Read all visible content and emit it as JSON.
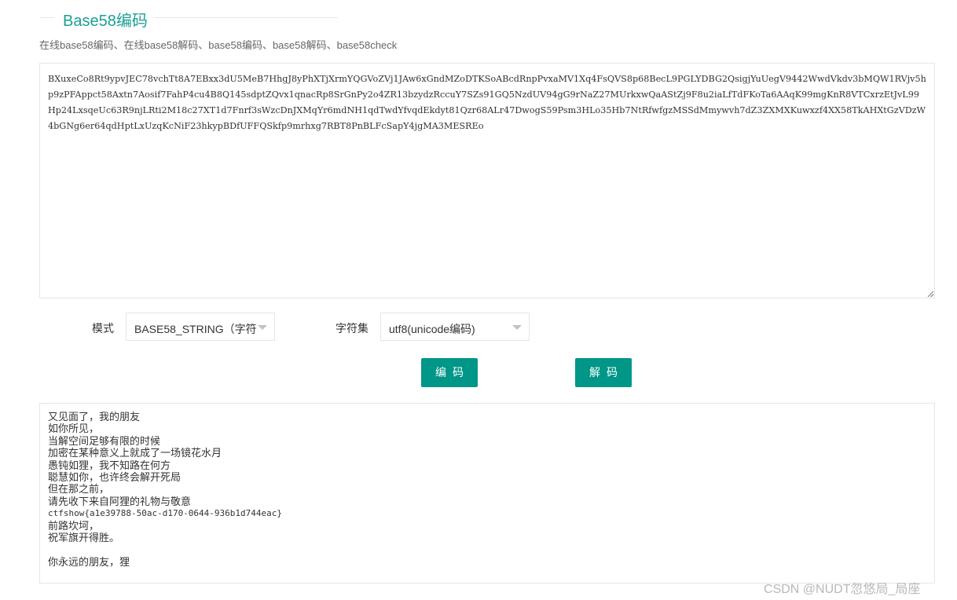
{
  "header": {
    "title": "Base58编码",
    "subtitle": "在线base58编码、在线base58解码、base58编码、base58解码、base58check"
  },
  "input": {
    "value": "BXuxeCo8Rt9ypvJEC78vchTt8A7EBxx3dU5MeB7HhgJ8yPhXTjXrmYQGVoZVj1JAw6xGndMZoDTKSoABcdRnpPvxaMV1Xq4FsQVS8p68BecL9PGLYDBG2QsigjYuUegV9442WwdVkdv3bMQW1RVjv5hp9zPFAppct58Axtn7Aosif7FahP4cu4B8Q145sdptZQvx1qnacRp8SrGnPy2o4ZR13bzydzRccuY7SZs91GQ5NzdUV94gG9rNaZ27MUrkxwQaAStZj9F8u2iaLfTdFKoTa6AAqK99mgKnR8VTCxrzEtJvL99Hp24LxsqeUc63R9njLRti2M18c27XT1d7Fnrf3sWzcDnJXMqYr6mdNH1qdTwdYfvqdEkdyt81Qzr68ALr47DwogS59Psm3HLo35Hb7NtRfwfgzMSSdMmywvh7dZ3ZXMXKuwxzf4XX58TkAHXtGzVDzW4bGNg6er64qdHptLxUzqKcNiF23hkypBDfUFFQSkfp9mrhxg7RBT8PnBLFcSapY4jgMA3MESREo"
  },
  "controls": {
    "mode_label": "模式",
    "mode_value": "BASE58_STRING（字符",
    "charset_label": "字符集",
    "charset_value": "utf8(unicode编码)",
    "encode_button": "编码",
    "decode_button": "解码"
  },
  "output": {
    "lines": [
      "又见面了，我的朋友",
      "如你所见，",
      "当解空间足够有限的时候",
      "加密在某种意义上就成了一场镜花水月",
      "愚钝如狸，我不知路在何方",
      "聪慧如你，也许终会解开死局",
      "但在那之前，",
      "请先收下来自阿狸的礼物与敬意",
      "ctfshow{a1e39788-50ac-d170-0644-936b1d744eac}",
      "前路坎坷，",
      "祝军旗开得胜。",
      "",
      "你永远的朋友，狸"
    ]
  },
  "watermark": "CSDN @NUDT忽悠局_局座",
  "colors": {
    "accent": "#009688",
    "title": "#1aa094",
    "border": "#e6e6e6"
  }
}
